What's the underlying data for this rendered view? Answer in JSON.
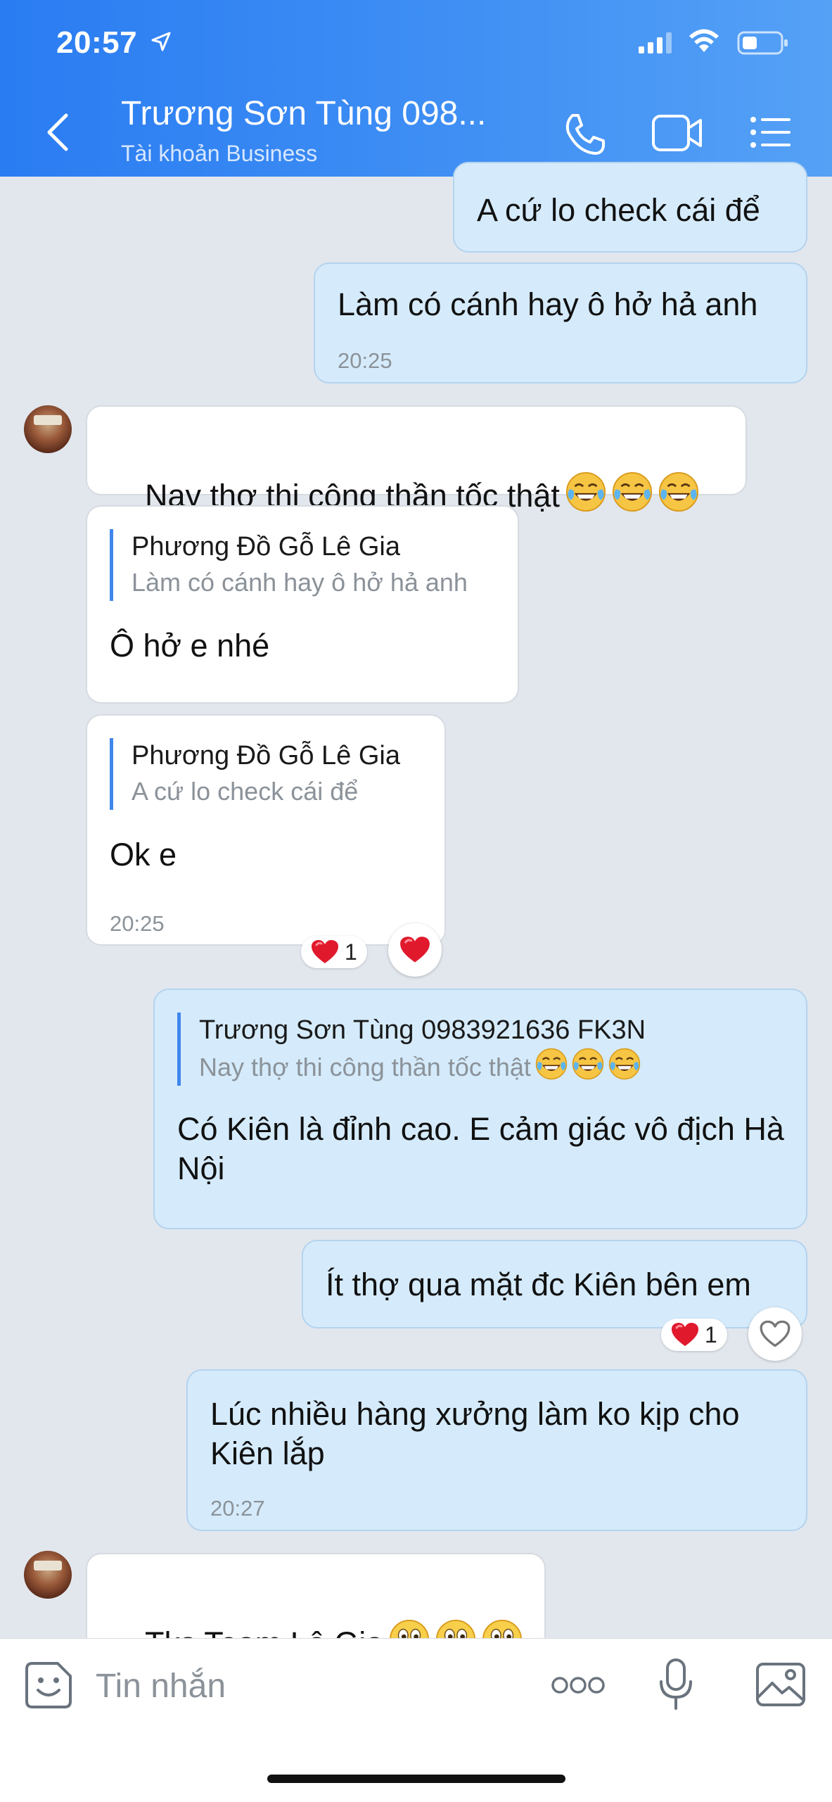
{
  "status_bar": {
    "time": "20:57"
  },
  "header": {
    "title": "Trương Sơn Tùng 098...",
    "subtitle": "Tài khoản Business"
  },
  "messages": [
    {
      "text": "A cứ lo check cái để"
    },
    {
      "text": "Làm có cánh hay ô hở hả anh",
      "time": "20:25"
    },
    {
      "text": "Nay thợ thi công thần tốc thật"
    },
    {
      "quote_name": "Phương Đồ Gỗ Lê Gia",
      "quote_text": "Làm có cánh hay ô hở hả anh",
      "text": "Ô hở e nhé"
    },
    {
      "quote_name": "Phương Đồ Gỗ Lê Gia",
      "quote_text": "A cứ lo check cái để",
      "text": "Ok e",
      "time": "20:25",
      "reaction_count": "1"
    },
    {
      "quote_name": "Trương Sơn Tùng 0983921636 FK3N",
      "quote_text": "Nay thợ thi công thần tốc thật",
      "text": "Có Kiên là đỉnh cao. E cảm giác vô địch Hà Nội"
    },
    {
      "text": "Ít thợ qua mặt đc Kiên bên em",
      "reaction_count": "1"
    },
    {
      "text": "Lúc nhiều hàng xưởng làm ko kịp cho Kiên lắp",
      "time": "20:27"
    },
    {
      "text": "Tks Team Lê Gia"
    }
  ],
  "input": {
    "placeholder": "Tin nhắn"
  },
  "icons": {
    "back": "chevron-left-icon",
    "call": "phone-icon",
    "video": "video-camera-icon",
    "menu": "list-menu-icon",
    "sticker": "sticker-smile-icon",
    "more": "more-dots-icon",
    "mic": "microphone-icon",
    "image": "image-icon",
    "laugh": "tears-of-joy-emoji",
    "smile": "slightly-smiling-emoji",
    "heart": "red-heart-emoji"
  },
  "colors": {
    "header": "#3b8cf4",
    "outgoing_bubble": "#d5ebfb",
    "incoming_bubble": "#ffffff",
    "quote_bar": "#3f86ec",
    "heart": "#e0192d"
  }
}
